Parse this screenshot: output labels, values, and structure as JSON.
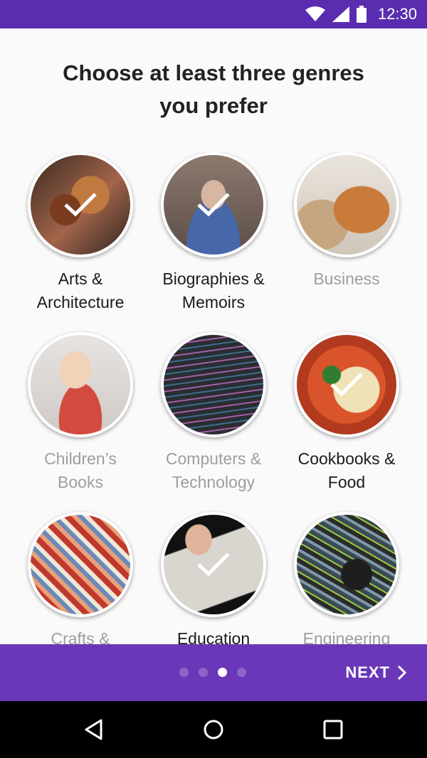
{
  "status_bar": {
    "time": "12:30"
  },
  "title": "Choose at least three genres\nyou prefer",
  "genres": [
    {
      "label": "Arts &\nArchitecture",
      "selected": true,
      "image": "arts"
    },
    {
      "label": "Biographies &\nMemoirs",
      "selected": true,
      "image": "bio"
    },
    {
      "label": "Business",
      "selected": false,
      "image": "biz"
    },
    {
      "label": "Children’s\nBooks",
      "selected": false,
      "image": "child"
    },
    {
      "label": "Computers &\nTechnology",
      "selected": false,
      "image": "comp"
    },
    {
      "label": "Cookbooks &\nFood",
      "selected": true,
      "image": "cook"
    },
    {
      "label": "Crafts &",
      "selected": false,
      "image": "craft"
    },
    {
      "label": "Education",
      "selected": true,
      "image": "edu"
    },
    {
      "label": "Engineering",
      "selected": false,
      "image": "eng"
    }
  ],
  "pager": {
    "total": 4,
    "current": 3
  },
  "next_label": "NEXT",
  "icons": {
    "wifi": "wifi-icon",
    "signal": "signal-icon",
    "battery": "battery-icon",
    "check": "check-icon",
    "chevron": "chevron-right-icon",
    "back": "back-icon",
    "home": "home-icon",
    "recents": "recents-icon"
  },
  "colors": {
    "status_bar": "#5a2db0",
    "bottom_bar": "#6a37b8",
    "dot_active": "#ffffff",
    "dot_inactive": "#8b66c9"
  }
}
